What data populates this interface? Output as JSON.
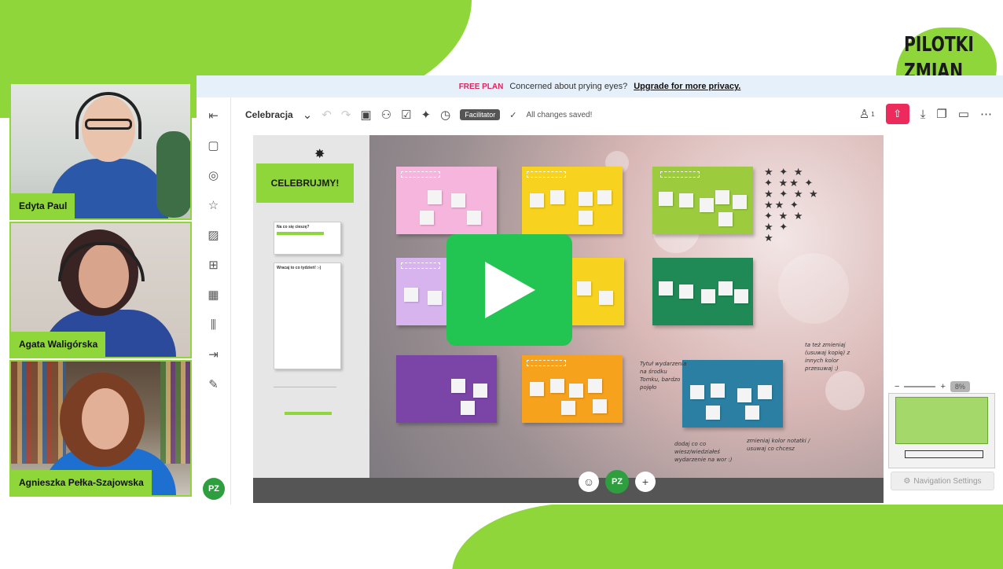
{
  "logo": {
    "line1": "PILOTKI",
    "line2": "ZMIAN"
  },
  "participants": [
    {
      "name": "Edyta Paul"
    },
    {
      "name": "Agata Waligórska"
    },
    {
      "name": "Agnieszka Pełka-Szajowska"
    }
  ],
  "banner": {
    "tag": "FREE PLAN",
    "text": "Concerned about prying eyes?",
    "link": "Upgrade for more privacy."
  },
  "toolbar": {
    "board_name": "Celebracja",
    "facilitator": "Facilitator",
    "saved": "All changes saved!",
    "collaborators": "1"
  },
  "board": {
    "title": "CELEBRUJMY!",
    "card1_title": "Na co się cieszę?",
    "card2_title": "Wracaj to co tydzień! :-)",
    "notes_handwriting": [
      "Tytuł wydarzenia na środku Tomku, bardzo pojęło",
      "ta też zmieniaj (usuwaj kopię) z innych kolor przesuwaj :)",
      "dodaj co co wiesz/wiedziałeś wydarzenie na wor :)",
      "zmieniaj kolor notatki / usuwaj co chcesz"
    ]
  },
  "bottom": {
    "avatar": "PZ"
  },
  "zoom": {
    "percent": "8%"
  },
  "navigation": {
    "label": "Navigation Settings"
  },
  "colors": {
    "accent": "#8ed63a",
    "play": "#23c552",
    "share": "#ec2a5c",
    "note_pink": "#f5b5dd",
    "note_yellow": "#f7d21e",
    "note_lime": "#9ccc3e",
    "note_lilac": "#d8b4ef",
    "note_green": "#1f8a56",
    "note_purple": "#7b45a7",
    "note_orange": "#f7a21c",
    "note_teal": "#2a7fa3"
  }
}
